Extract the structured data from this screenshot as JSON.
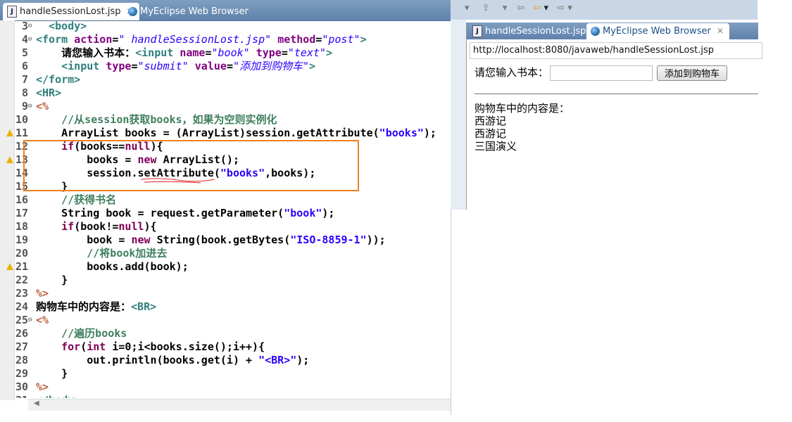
{
  "editor": {
    "tabs": [
      {
        "label": "handleSessionLost.jsp",
        "icon": "jsp-file-icon",
        "active": true
      },
      {
        "label": "MyEclipse Web Browser",
        "icon": "globe-icon",
        "active": false
      }
    ],
    "lines": [
      {
        "n": "3",
        "mk": "fold",
        "t": [
          [
            "  <body>",
            "tag"
          ]
        ]
      },
      {
        "n": "4",
        "mk": "fold",
        "t": [
          [
            "<form ",
            "tag"
          ],
          [
            "action",
            "attr"
          ],
          [
            "=",
            "pl"
          ],
          [
            "\" handleSessionLost.jsp\"",
            "str"
          ],
          [
            " ",
            "pl"
          ],
          [
            "method",
            "attr"
          ],
          [
            "=",
            "pl"
          ],
          [
            "\"post\"",
            "str"
          ],
          [
            ">",
            "tag"
          ]
        ]
      },
      {
        "n": "5",
        "t": [
          [
            "    请您输入书本：",
            "pl"
          ],
          [
            "<input ",
            "tag"
          ],
          [
            "name",
            "attr"
          ],
          [
            "=",
            "pl"
          ],
          [
            "\"book\"",
            "str"
          ],
          [
            " ",
            "pl"
          ],
          [
            "type",
            "attr"
          ],
          [
            "=",
            "pl"
          ],
          [
            "\"text\"",
            "str"
          ],
          [
            ">",
            "tag"
          ]
        ]
      },
      {
        "n": "6",
        "t": [
          [
            "    ",
            "pl"
          ],
          [
            "<input ",
            "tag"
          ],
          [
            "type",
            "attr"
          ],
          [
            "=",
            "pl"
          ],
          [
            "\"submit\"",
            "str"
          ],
          [
            " ",
            "pl"
          ],
          [
            "value",
            "attr"
          ],
          [
            "=",
            "pl"
          ],
          [
            "\"添加到购物车\"",
            "str"
          ],
          [
            ">",
            "tag"
          ]
        ]
      },
      {
        "n": "7",
        "t": [
          [
            "</form>",
            "tag"
          ]
        ]
      },
      {
        "n": "8",
        "t": [
          [
            "<HR>",
            "tag"
          ]
        ]
      },
      {
        "n": "9",
        "mk": "fold",
        "t": [
          [
            "<%",
            "jsp"
          ]
        ]
      },
      {
        "n": "10",
        "t": [
          [
            "    //从session获取books，如果为空则实例化",
            "cm"
          ]
        ]
      },
      {
        "n": "11",
        "warn": true,
        "t": [
          [
            "    ArrayList books = (ArrayList)session.getAttribute(",
            "pl"
          ],
          [
            "\"books\"",
            "s2"
          ],
          [
            ");",
            "pl"
          ]
        ]
      },
      {
        "n": "12",
        "t": [
          [
            "    ",
            "pl"
          ],
          [
            "if",
            "kw"
          ],
          [
            "(books==",
            "pl"
          ],
          [
            "null",
            "kw"
          ],
          [
            "){",
            "pl"
          ]
        ]
      },
      {
        "n": "13",
        "warn": true,
        "t": [
          [
            "        books = ",
            "pl"
          ],
          [
            "new",
            "kw"
          ],
          [
            " ArrayList();",
            "pl"
          ]
        ]
      },
      {
        "n": "14",
        "t": [
          [
            "        session.setAttribute(",
            "pl"
          ],
          [
            "\"books\"",
            "s2"
          ],
          [
            ",books);",
            "pl"
          ]
        ]
      },
      {
        "n": "15",
        "t": [
          [
            "    }",
            "pl"
          ]
        ]
      },
      {
        "n": "16",
        "t": [
          [
            "    //获得书名",
            "cm"
          ]
        ]
      },
      {
        "n": "17",
        "t": [
          [
            "    String book = request.getParameter(",
            "pl"
          ],
          [
            "\"book\"",
            "s2"
          ],
          [
            ");",
            "pl"
          ]
        ]
      },
      {
        "n": "18",
        "t": [
          [
            "    ",
            "pl"
          ],
          [
            "if",
            "kw"
          ],
          [
            "(book!=",
            "pl"
          ],
          [
            "null",
            "kw"
          ],
          [
            "){",
            "pl"
          ]
        ]
      },
      {
        "n": "19",
        "t": [
          [
            "        book = ",
            "pl"
          ],
          [
            "new",
            "kw"
          ],
          [
            " String(book.getBytes(",
            "pl"
          ],
          [
            "\"ISO-8859-1\"",
            "s2"
          ],
          [
            "));",
            "pl"
          ]
        ]
      },
      {
        "n": "20",
        "t": [
          [
            "        //将book加进去",
            "cm"
          ]
        ]
      },
      {
        "n": "21",
        "warn": true,
        "t": [
          [
            "        books.add(book);",
            "pl"
          ]
        ]
      },
      {
        "n": "22",
        "t": [
          [
            "    }",
            "pl"
          ]
        ]
      },
      {
        "n": "23",
        "t": [
          [
            "%>",
            "jsp"
          ]
        ]
      },
      {
        "n": "24",
        "t": [
          [
            "购物车中的内容是：",
            "pl"
          ],
          [
            "<BR>",
            "tag"
          ]
        ]
      },
      {
        "n": "25",
        "mk": "fold",
        "t": [
          [
            "<%",
            "jsp"
          ]
        ]
      },
      {
        "n": "26",
        "t": [
          [
            "    //遍历books",
            "cm"
          ]
        ]
      },
      {
        "n": "27",
        "t": [
          [
            "    ",
            "pl"
          ],
          [
            "for",
            "kw"
          ],
          [
            "(",
            "pl"
          ],
          [
            "int",
            "kw"
          ],
          [
            " i=0;i<books.size();i++){",
            "pl"
          ]
        ]
      },
      {
        "n": "28",
        "t": [
          [
            "        out.println(books.get(i) + ",
            "pl"
          ],
          [
            "\"<BR>\"",
            "s2"
          ],
          [
            ");",
            "pl"
          ]
        ]
      },
      {
        "n": "29",
        "t": [
          [
            "    }",
            "pl"
          ]
        ]
      },
      {
        "n": "30",
        "t": [
          [
            "%>",
            "jsp"
          ]
        ]
      },
      {
        "n": "31",
        "t": [
          [
            "</body>",
            "tag"
          ]
        ]
      }
    ]
  },
  "browser": {
    "tabs": [
      {
        "label": "handleSessionLost.jsp",
        "icon": "jsp-file-icon"
      },
      {
        "label": "MyEclipse Web Browser",
        "icon": "globe-icon"
      }
    ],
    "url": "http://localhost:8080/javaweb/handleSessionLost.jsp",
    "prompt": "请您输入书本：",
    "input_value": "",
    "submit_label": "添加到购物车",
    "cart_heading": "购物车中的内容是：",
    "cart_items": [
      "西游记",
      "西游记",
      "三国演义"
    ]
  },
  "colors": {
    "highlight_box": "#f08020",
    "tab_bar": "#6a8db5"
  }
}
